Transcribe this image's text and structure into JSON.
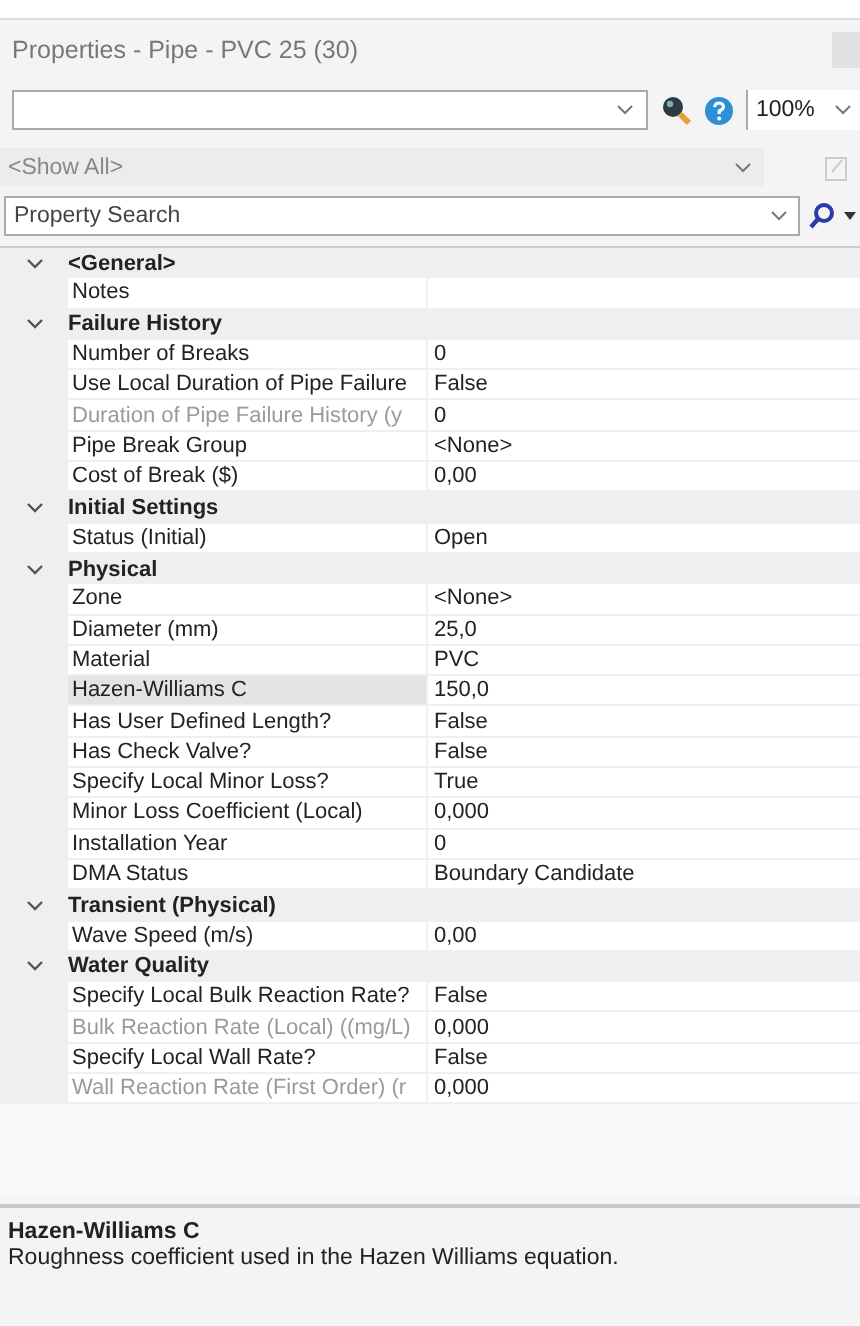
{
  "window": {
    "title": "Properties - Pipe - PVC 25 (30)"
  },
  "toolbar": {
    "zoom": "100%"
  },
  "filter": {
    "value": "<Show All>",
    "disabled": true
  },
  "search": {
    "placeholder": "Property Search"
  },
  "categories": [
    {
      "name": "<General>",
      "expanded": true,
      "properties": [
        {
          "label": "Notes",
          "disabled": false,
          "selected": false
        }
      ]
    },
    {
      "name": "Failure History",
      "expanded": true,
      "properties": [
        {
          "label": "Number of Breaks",
          "value": "0",
          "disabled": false,
          "selected": false
        },
        {
          "label": "Use Local Duration of Pipe Failure",
          "value": "False",
          "disabled": false,
          "selected": false
        },
        {
          "label": "Duration of Pipe Failure History (y",
          "value": "0",
          "disabled": true,
          "selected": false
        },
        {
          "label": "Pipe Break Group",
          "value": "<None>",
          "disabled": false,
          "selected": false
        },
        {
          "label": "Cost of Break ($)",
          "value": "0,00",
          "disabled": false,
          "selected": false
        }
      ]
    },
    {
      "name": "Initial Settings",
      "expanded": true,
      "properties": [
        {
          "label": "Status (Initial)",
          "value": "Open",
          "disabled": false,
          "selected": false
        }
      ]
    },
    {
      "name": "Physical",
      "expanded": true,
      "properties": [
        {
          "label": "Zone",
          "value": "<None>",
          "disabled": false,
          "selected": false
        },
        {
          "label": "Diameter (mm)",
          "value": "25,0",
          "disabled": false,
          "selected": false
        },
        {
          "label": "Material",
          "value": "PVC",
          "disabled": false,
          "selected": false
        },
        {
          "label": "Hazen-Williams C",
          "value": "150,0",
          "disabled": false,
          "selected": true
        },
        {
          "label": "Has User Defined Length?",
          "value": "False",
          "disabled": false,
          "selected": false
        },
        {
          "label": "Has Check Valve?",
          "value": "False",
          "disabled": false,
          "selected": false
        },
        {
          "label": "Specify Local Minor Loss?",
          "value": "True",
          "disabled": false,
          "selected": false
        },
        {
          "label": "Minor Loss Coefficient (Local)",
          "value": "0,000",
          "disabled": false,
          "selected": false
        },
        {
          "label": "Installation Year",
          "value": "0",
          "disabled": false,
          "selected": false
        },
        {
          "label": "DMA Status",
          "value": "Boundary Candidate",
          "disabled": false,
          "selected": false
        }
      ]
    },
    {
      "name": "Transient (Physical)",
      "expanded": true,
      "properties": [
        {
          "label": "Wave Speed (m/s)",
          "value": "0,00",
          "disabled": false,
          "selected": false
        }
      ]
    },
    {
      "name": "Water Quality",
      "expanded": true,
      "properties": [
        {
          "label": "Specify Local Bulk Reaction Rate?",
          "value": "False",
          "disabled": false,
          "selected": false
        },
        {
          "label": "Bulk Reaction Rate (Local) ((mg/L)",
          "value": "0,000",
          "disabled": true,
          "selected": false
        },
        {
          "label": "Specify Local Wall Rate?",
          "value": "False",
          "disabled": false,
          "selected": false
        },
        {
          "label": "Wall Reaction Rate (First Order) (r",
          "value": "0,000",
          "disabled": true,
          "selected": false
        }
      ]
    }
  ],
  "description": {
    "title": "Hazen-Williams C",
    "text": "Roughness coefficient used in the Hazen Williams equation."
  }
}
